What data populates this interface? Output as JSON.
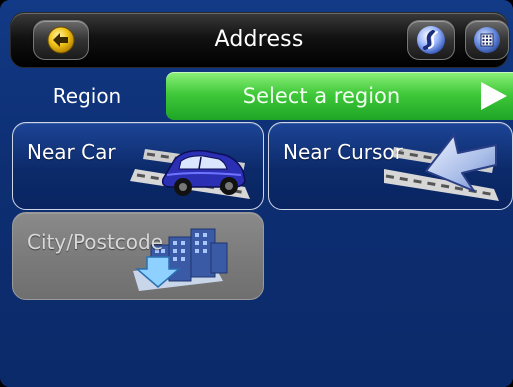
{
  "header": {
    "title": "Address",
    "back_icon": "back-arrow-icon",
    "logo_icon": "brand-logo-icon",
    "menu_icon": "menu-grid-icon"
  },
  "region": {
    "label": "Region",
    "select_label": "Select a region"
  },
  "tiles": [
    {
      "label": "Near Car",
      "icon": "car-icon",
      "enabled": true
    },
    {
      "label": "Near Cursor",
      "icon": "cursor-arrow-icon",
      "enabled": true
    },
    {
      "label": "City/Postcode",
      "icon": "city-buildings-icon",
      "enabled": false
    }
  ],
  "colors": {
    "background": "#0e2f74",
    "accent_green": "#41c93b",
    "disabled_gray": "#7a7a7a"
  }
}
